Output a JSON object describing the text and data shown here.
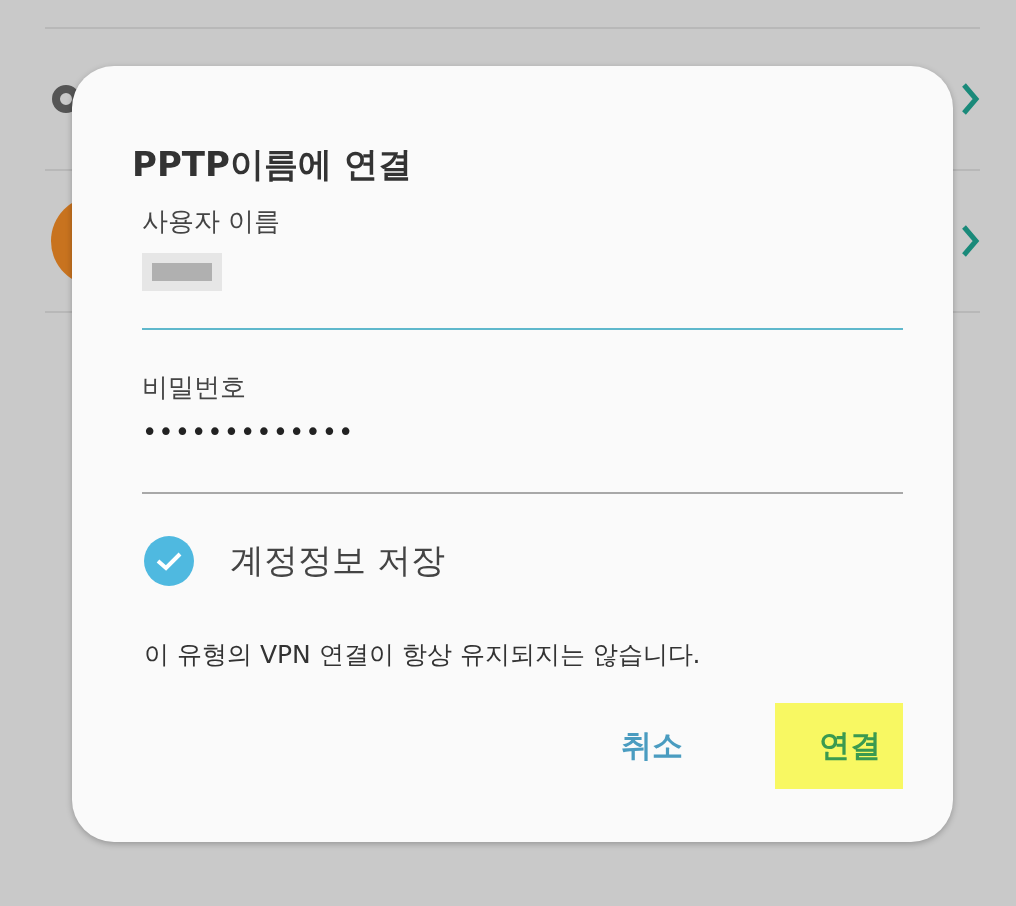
{
  "dialog": {
    "title": "PPTP이름에 연결",
    "fields": [
      {
        "kind": "redacted",
        "label": "사용자 이름",
        "focused": true
      },
      {
        "kind": "password",
        "label": "비밀번호",
        "value": "•••••••••••••",
        "focused": false
      }
    ],
    "save_account": {
      "label": "계정정보 저장",
      "checked": true
    },
    "note": "이 유형의 VPN 연결이 항상 유지되지는 않습니다.",
    "buttons": [
      {
        "label": "취소",
        "highlighted": false
      },
      {
        "label": "연결",
        "highlighted": true
      }
    ]
  }
}
